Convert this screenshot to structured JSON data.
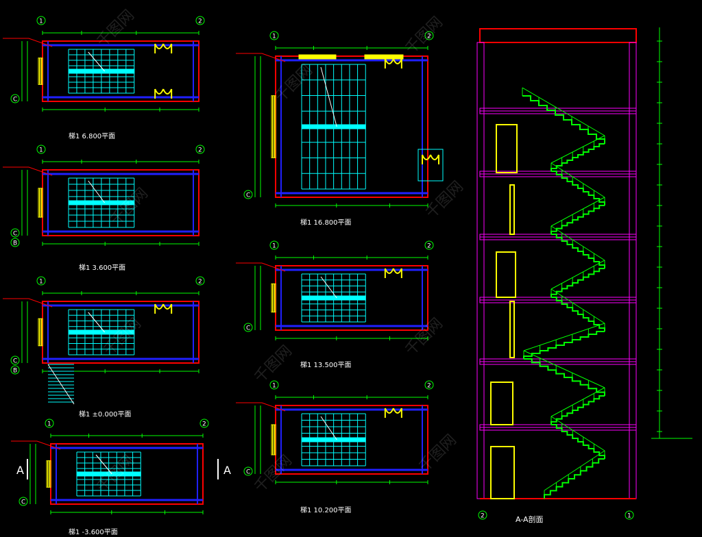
{
  "axes": {
    "a1": "1",
    "a2": "2",
    "b": "B",
    "c": "C",
    "section": "A"
  },
  "labels": {
    "plan_1": "梯1 6.800平面",
    "plan_2": "梯1 3.600平面",
    "plan_3": "梯1 ±0.000平面",
    "plan_4": "梯1 -3.600平面",
    "plan_5": "梯1 16.800平面",
    "plan_6": "梯1 13.500平面",
    "plan_7": "梯1 10.200平面",
    "section": "A-A剖面"
  },
  "watermark": "千图网",
  "colors": {
    "background": "#000000",
    "wall": "#ff0000",
    "beam": "#2020ff",
    "dim": "#00ff00",
    "stair": "#00ffff",
    "door": "#ffff00",
    "slab": "#ff00ff",
    "leader": "#ff0000"
  }
}
